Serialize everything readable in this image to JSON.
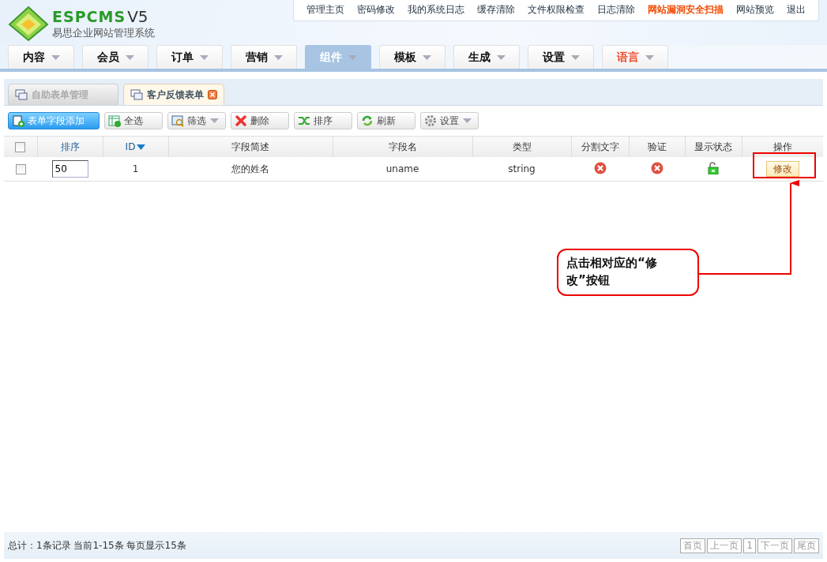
{
  "logo": {
    "brand": "ESPCMS",
    "version": "V5",
    "subtitle": "易思企业网站管理系统"
  },
  "top_links": [
    {
      "label": "管理主页",
      "highlight": false
    },
    {
      "label": "密码修改",
      "highlight": false
    },
    {
      "label": "我的系统日志",
      "highlight": false
    },
    {
      "label": "缓存清除",
      "highlight": false
    },
    {
      "label": "文件权限检查",
      "highlight": false
    },
    {
      "label": "日志清除",
      "highlight": false
    },
    {
      "label": "网站漏洞安全扫描",
      "highlight": true
    },
    {
      "label": "网站预览",
      "highlight": false
    },
    {
      "label": "退出",
      "highlight": false
    }
  ],
  "main_menu": [
    {
      "label": "内容",
      "selected": false,
      "highlight": false
    },
    {
      "label": "会员",
      "selected": false,
      "highlight": false
    },
    {
      "label": "订单",
      "selected": false,
      "highlight": false
    },
    {
      "label": "营销",
      "selected": false,
      "highlight": false
    },
    {
      "label": "组件",
      "selected": true,
      "highlight": false
    },
    {
      "label": "模板",
      "selected": false,
      "highlight": false
    },
    {
      "label": "生成",
      "selected": false,
      "highlight": false
    },
    {
      "label": "设置",
      "selected": false,
      "highlight": false
    },
    {
      "label": "语言",
      "selected": false,
      "highlight": true
    }
  ],
  "sub_tabs": [
    {
      "label": "自助表单管理",
      "selected": false,
      "closable": false
    },
    {
      "label": "客户反馈表单",
      "selected": true,
      "closable": true
    }
  ],
  "toolbar": [
    {
      "label": "表单字段添加",
      "kind": "add",
      "primary": true,
      "dropdown": false
    },
    {
      "label": "全选",
      "kind": "select",
      "primary": false,
      "dropdown": false
    },
    {
      "label": "筛选",
      "kind": "filter",
      "primary": false,
      "dropdown": true
    },
    {
      "label": "删除",
      "kind": "delete",
      "primary": false,
      "dropdown": false
    },
    {
      "label": "排序",
      "kind": "sort",
      "primary": false,
      "dropdown": false
    },
    {
      "label": "刷新",
      "kind": "refresh",
      "primary": false,
      "dropdown": false
    },
    {
      "label": "设置",
      "kind": "settings",
      "primary": false,
      "dropdown": true
    }
  ],
  "table": {
    "header_checked": false,
    "columns": [
      {
        "label": "排序",
        "link": true,
        "sorted": false
      },
      {
        "label": "ID",
        "link": true,
        "sorted": true
      },
      {
        "label": "字段简述",
        "link": false,
        "sorted": false
      },
      {
        "label": "字段名",
        "link": false,
        "sorted": false
      },
      {
        "label": "类型",
        "link": false,
        "sorted": false
      },
      {
        "label": "分割文字",
        "link": false,
        "sorted": false
      },
      {
        "label": "验证",
        "link": false,
        "sorted": false
      },
      {
        "label": "显示状态",
        "link": false,
        "sorted": false
      },
      {
        "label": "操作",
        "link": false,
        "sorted": false
      }
    ],
    "rows": [
      {
        "checked": false,
        "order": "50",
        "id": "1",
        "description": "您的姓名",
        "name": "uname",
        "type": "string",
        "split": false,
        "verify": false,
        "visible": true,
        "action": "修改"
      }
    ]
  },
  "annotation": {
    "text": "点击相对应的“修改”按钮"
  },
  "footer": {
    "summary": "总计：1条记录 当前1-15条 每页显示15条",
    "pager": [
      {
        "label": "首页"
      },
      {
        "label": "上一页"
      },
      {
        "label": "1"
      },
      {
        "label": "下一页"
      },
      {
        "label": "尾页"
      }
    ]
  }
}
